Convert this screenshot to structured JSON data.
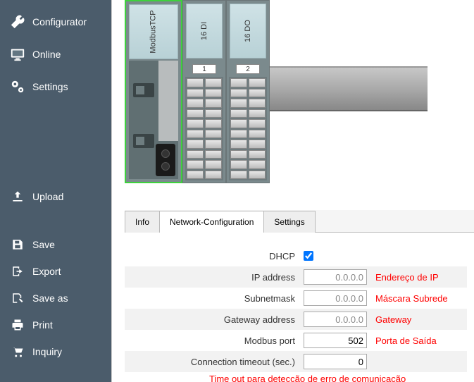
{
  "sidebar": {
    "items": [
      {
        "label": "Configurator"
      },
      {
        "label": "Online"
      },
      {
        "label": "Settings"
      },
      {
        "label": "Upload"
      },
      {
        "label": "Save"
      },
      {
        "label": "Export"
      },
      {
        "label": "Save as"
      },
      {
        "label": "Print"
      },
      {
        "label": "Inquiry"
      }
    ]
  },
  "device": {
    "modules": [
      {
        "label": "ModbusTCP"
      },
      {
        "label": "16 DI",
        "slot": "1"
      },
      {
        "label": "16 DO",
        "slot": "2"
      }
    ]
  },
  "tabs": {
    "info": "Info",
    "network": "Network-Configuration",
    "settings": "Settings"
  },
  "form": {
    "dhcp_label": "DHCP",
    "dhcp_checked": true,
    "ip_label": "IP address",
    "ip_value": "0.0.0.0",
    "ip_annot": "Endereço de IP",
    "subnet_label": "Subnetmask",
    "subnet_value": "0.0.0.0",
    "subnet_annot": "Máscara Subrede",
    "gateway_label": "Gateway address",
    "gateway_value": "0.0.0.0",
    "gateway_annot": "Gateway",
    "port_label": "Modbus port",
    "port_value": "502",
    "port_annot": "Porta de Saída",
    "timeout_label": "Connection timeout (sec.)",
    "timeout_value": "0",
    "timeout_annot": "Time out para detecção de erro de comunicação"
  }
}
